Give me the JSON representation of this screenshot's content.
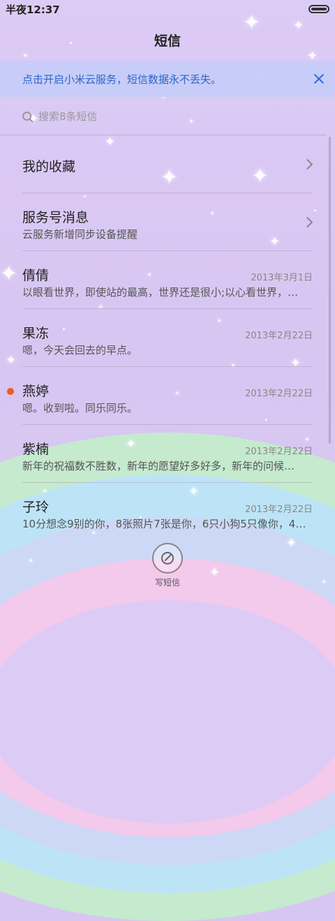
{
  "status": {
    "time": "半夜12:37"
  },
  "header": {
    "title": "短信"
  },
  "banner": {
    "text": "点击开启小米云服务，短信数据永不丢失。"
  },
  "search": {
    "placeholder": "搜索8条短信"
  },
  "conversations": [
    {
      "name": "我的收藏",
      "preview": "",
      "date": "",
      "chevron": true,
      "unread": false
    },
    {
      "name": "服务号消息",
      "preview": "云服务新增同步设备提醒",
      "date": "",
      "chevron": true,
      "unread": false
    },
    {
      "name": "倩倩",
      "preview": "以眼看世界，即使站的最高，世界还是很小;以心看世界，…",
      "date": "2013年3月1日",
      "chevron": false,
      "unread": false
    },
    {
      "name": "果冻",
      "preview": "嗯，今天会回去的早点。",
      "date": "2013年2月22日",
      "chevron": false,
      "unread": false
    },
    {
      "name": "燕婷",
      "preview": "嗯。收到啦。同乐同乐。",
      "date": "2013年2月22日",
      "chevron": false,
      "unread": true
    },
    {
      "name": "紫楠",
      "preview": "新年的祝福数不胜数，新年的愿望好多好多，新年的问候…",
      "date": "2013年2月22日",
      "chevron": false,
      "unread": false
    },
    {
      "name": "子玲",
      "preview": "10分想念9别的你，8张照片7张是你，6只小狗5只像你，4…",
      "date": "2013年2月22日",
      "chevron": false,
      "unread": false
    }
  ],
  "compose": {
    "label": "写短信"
  },
  "colors": {
    "accent": "#2e64c8",
    "unread": "#f05a1a"
  }
}
